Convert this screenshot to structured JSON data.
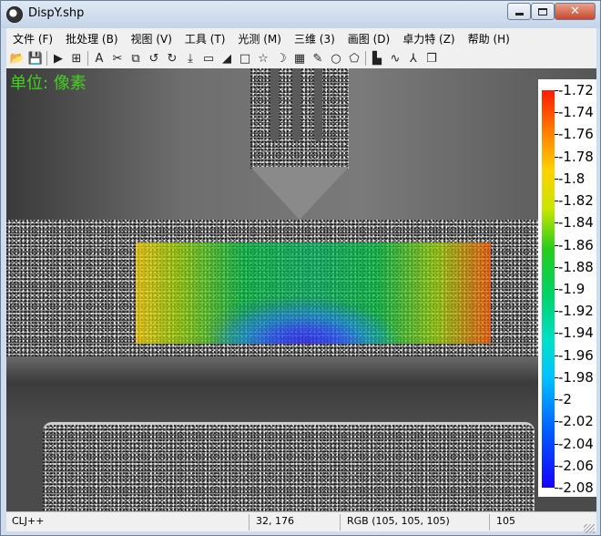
{
  "window": {
    "title": "DispY.shp",
    "app_icon": "yin-yang-icon"
  },
  "menu": [
    {
      "label": "文件 (F)",
      "name": "menu-file"
    },
    {
      "label": "批处理 (B)",
      "name": "menu-batch"
    },
    {
      "label": "视图 (V)",
      "name": "menu-view"
    },
    {
      "label": "工具 (T)",
      "name": "menu-tools"
    },
    {
      "label": "光测 (M)",
      "name": "menu-optical"
    },
    {
      "label": "三维 (3)",
      "name": "menu-3d"
    },
    {
      "label": "画图 (D)",
      "name": "menu-draw"
    },
    {
      "label": "卓力特 (Z)",
      "name": "menu-zhuolite"
    },
    {
      "label": "帮助 (H)",
      "name": "menu-help"
    }
  ],
  "toolbar": [
    {
      "name": "open-folder-icon",
      "glyph": "📂"
    },
    {
      "name": "save-icon",
      "glyph": "💾"
    },
    {
      "sep": true
    },
    {
      "name": "play-icon",
      "glyph": "▶"
    },
    {
      "name": "layout-icon",
      "glyph": "⊞"
    },
    {
      "sep": true
    },
    {
      "name": "text-icon",
      "glyph": "A"
    },
    {
      "name": "scissors-icon",
      "glyph": "✂"
    },
    {
      "name": "crop-icon",
      "glyph": "⧉"
    },
    {
      "name": "rotate-left-icon",
      "glyph": "↺"
    },
    {
      "name": "rotate-right-icon",
      "glyph": "↻"
    },
    {
      "name": "download-icon",
      "glyph": "⤓"
    },
    {
      "name": "ruler-icon",
      "glyph": "▭"
    },
    {
      "name": "bar-ramp-icon",
      "glyph": "◢"
    },
    {
      "name": "rectangle-icon",
      "glyph": "□"
    },
    {
      "name": "star-icon",
      "glyph": "☆"
    },
    {
      "name": "crescent-icon",
      "glyph": "☽"
    },
    {
      "name": "colormap-icon",
      "glyph": "▦"
    },
    {
      "name": "pencil-icon",
      "glyph": "✎"
    },
    {
      "name": "circle-icon",
      "glyph": "○"
    },
    {
      "name": "polygon-icon",
      "glyph": "⬠"
    },
    {
      "sep": true
    },
    {
      "name": "histogram-icon",
      "glyph": "▙"
    },
    {
      "name": "waveform-icon",
      "glyph": "∿"
    },
    {
      "name": "axes-icon",
      "glyph": "⅄"
    },
    {
      "name": "cube-icon",
      "glyph": "❒"
    }
  ],
  "overlay": {
    "unit_label": "单位: 像素"
  },
  "colorbar": {
    "labels": [
      "-1.72",
      "-1.74",
      "-1.76",
      "-1.78",
      "-1.8",
      "-1.82",
      "-1.84",
      "-1.86",
      "-1.88",
      "-1.9",
      "-1.92",
      "-1.94",
      "-1.96",
      "-1.98",
      "-2",
      "-2.02",
      "-2.04",
      "-2.06",
      "-2.08"
    ],
    "colors": {
      "max": "#ff1a00",
      "mid": "#27cc1c",
      "min": "#1600ff"
    }
  },
  "statusbar": {
    "mode": "CLJ++",
    "coords": "32, 176",
    "rgb": "RGB (105, 105, 105)",
    "value": "105"
  }
}
